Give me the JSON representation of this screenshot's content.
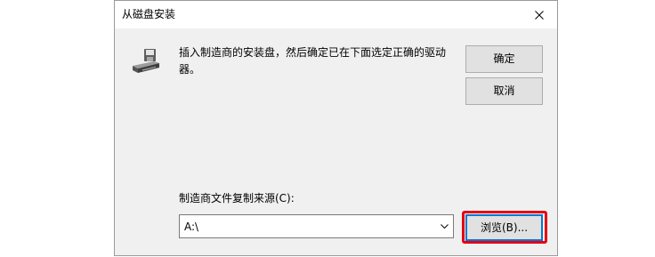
{
  "colors": {
    "page_bg": "#ffffff",
    "title_bar": "#ffffff",
    "dialog_body": "#f0f0f0",
    "dialog_border": "#9a9a9a",
    "button_face": "#e1e1e1",
    "button_border": "#adadad",
    "focus_border": "#0078d7",
    "field_border": "#7a7a7a",
    "highlight": "#e60012"
  },
  "dialog": {
    "title": "从磁盘安装",
    "close_icon": "close-icon"
  },
  "prompt": {
    "icon": "floppy-drive-icon",
    "message": "插入制造商的安装盘，然后确定已在下面选定正确的驱动器。"
  },
  "buttons": {
    "ok": "确定",
    "cancel": "取消",
    "browse": "浏览(B)..."
  },
  "source": {
    "label": "制造商文件复制来源(C):",
    "value": "A:\\",
    "dropdown_icon": "chevron-down-icon"
  }
}
